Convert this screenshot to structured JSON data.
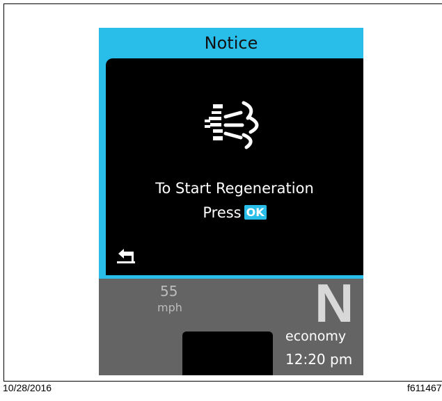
{
  "header": {
    "title": "Notice"
  },
  "message": {
    "line1": "To Start Regeneration",
    "line2_prefix": "Press",
    "ok_badge": "OK"
  },
  "icons": {
    "regen": "dpf-regeneration-icon",
    "back": "back-arrow-icon"
  },
  "status_bar": {
    "speed_value": "55",
    "speed_unit": "mph",
    "gear": "N",
    "mode": "economy",
    "time": "12:20 pm"
  },
  "footer": {
    "date": "10/28/2016",
    "figure_id": "f611467"
  },
  "colors": {
    "accent": "#29bde9",
    "panel": "#000000",
    "status_bg": "#646464"
  }
}
